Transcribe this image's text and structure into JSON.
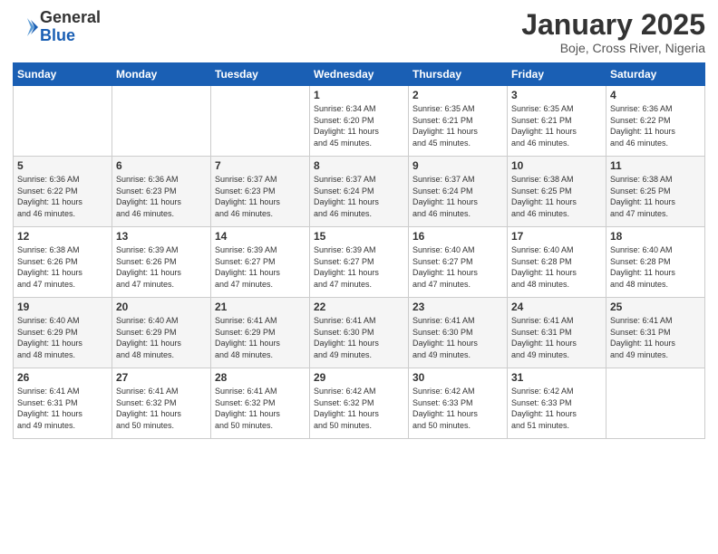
{
  "header": {
    "logo_general": "General",
    "logo_blue": "Blue",
    "month_title": "January 2025",
    "location": "Boje, Cross River, Nigeria"
  },
  "weekdays": [
    "Sunday",
    "Monday",
    "Tuesday",
    "Wednesday",
    "Thursday",
    "Friday",
    "Saturday"
  ],
  "weeks": [
    [
      {
        "day": "",
        "info": ""
      },
      {
        "day": "",
        "info": ""
      },
      {
        "day": "",
        "info": ""
      },
      {
        "day": "1",
        "info": "Sunrise: 6:34 AM\nSunset: 6:20 PM\nDaylight: 11 hours\nand 45 minutes."
      },
      {
        "day": "2",
        "info": "Sunrise: 6:35 AM\nSunset: 6:21 PM\nDaylight: 11 hours\nand 45 minutes."
      },
      {
        "day": "3",
        "info": "Sunrise: 6:35 AM\nSunset: 6:21 PM\nDaylight: 11 hours\nand 46 minutes."
      },
      {
        "day": "4",
        "info": "Sunrise: 6:36 AM\nSunset: 6:22 PM\nDaylight: 11 hours\nand 46 minutes."
      }
    ],
    [
      {
        "day": "5",
        "info": "Sunrise: 6:36 AM\nSunset: 6:22 PM\nDaylight: 11 hours\nand 46 minutes."
      },
      {
        "day": "6",
        "info": "Sunrise: 6:36 AM\nSunset: 6:23 PM\nDaylight: 11 hours\nand 46 minutes."
      },
      {
        "day": "7",
        "info": "Sunrise: 6:37 AM\nSunset: 6:23 PM\nDaylight: 11 hours\nand 46 minutes."
      },
      {
        "day": "8",
        "info": "Sunrise: 6:37 AM\nSunset: 6:24 PM\nDaylight: 11 hours\nand 46 minutes."
      },
      {
        "day": "9",
        "info": "Sunrise: 6:37 AM\nSunset: 6:24 PM\nDaylight: 11 hours\nand 46 minutes."
      },
      {
        "day": "10",
        "info": "Sunrise: 6:38 AM\nSunset: 6:25 PM\nDaylight: 11 hours\nand 46 minutes."
      },
      {
        "day": "11",
        "info": "Sunrise: 6:38 AM\nSunset: 6:25 PM\nDaylight: 11 hours\nand 47 minutes."
      }
    ],
    [
      {
        "day": "12",
        "info": "Sunrise: 6:38 AM\nSunset: 6:26 PM\nDaylight: 11 hours\nand 47 minutes."
      },
      {
        "day": "13",
        "info": "Sunrise: 6:39 AM\nSunset: 6:26 PM\nDaylight: 11 hours\nand 47 minutes."
      },
      {
        "day": "14",
        "info": "Sunrise: 6:39 AM\nSunset: 6:27 PM\nDaylight: 11 hours\nand 47 minutes."
      },
      {
        "day": "15",
        "info": "Sunrise: 6:39 AM\nSunset: 6:27 PM\nDaylight: 11 hours\nand 47 minutes."
      },
      {
        "day": "16",
        "info": "Sunrise: 6:40 AM\nSunset: 6:27 PM\nDaylight: 11 hours\nand 47 minutes."
      },
      {
        "day": "17",
        "info": "Sunrise: 6:40 AM\nSunset: 6:28 PM\nDaylight: 11 hours\nand 48 minutes."
      },
      {
        "day": "18",
        "info": "Sunrise: 6:40 AM\nSunset: 6:28 PM\nDaylight: 11 hours\nand 48 minutes."
      }
    ],
    [
      {
        "day": "19",
        "info": "Sunrise: 6:40 AM\nSunset: 6:29 PM\nDaylight: 11 hours\nand 48 minutes."
      },
      {
        "day": "20",
        "info": "Sunrise: 6:40 AM\nSunset: 6:29 PM\nDaylight: 11 hours\nand 48 minutes."
      },
      {
        "day": "21",
        "info": "Sunrise: 6:41 AM\nSunset: 6:29 PM\nDaylight: 11 hours\nand 48 minutes."
      },
      {
        "day": "22",
        "info": "Sunrise: 6:41 AM\nSunset: 6:30 PM\nDaylight: 11 hours\nand 49 minutes."
      },
      {
        "day": "23",
        "info": "Sunrise: 6:41 AM\nSunset: 6:30 PM\nDaylight: 11 hours\nand 49 minutes."
      },
      {
        "day": "24",
        "info": "Sunrise: 6:41 AM\nSunset: 6:31 PM\nDaylight: 11 hours\nand 49 minutes."
      },
      {
        "day": "25",
        "info": "Sunrise: 6:41 AM\nSunset: 6:31 PM\nDaylight: 11 hours\nand 49 minutes."
      }
    ],
    [
      {
        "day": "26",
        "info": "Sunrise: 6:41 AM\nSunset: 6:31 PM\nDaylight: 11 hours\nand 49 minutes."
      },
      {
        "day": "27",
        "info": "Sunrise: 6:41 AM\nSunset: 6:32 PM\nDaylight: 11 hours\nand 50 minutes."
      },
      {
        "day": "28",
        "info": "Sunrise: 6:41 AM\nSunset: 6:32 PM\nDaylight: 11 hours\nand 50 minutes."
      },
      {
        "day": "29",
        "info": "Sunrise: 6:42 AM\nSunset: 6:32 PM\nDaylight: 11 hours\nand 50 minutes."
      },
      {
        "day": "30",
        "info": "Sunrise: 6:42 AM\nSunset: 6:33 PM\nDaylight: 11 hours\nand 50 minutes."
      },
      {
        "day": "31",
        "info": "Sunrise: 6:42 AM\nSunset: 6:33 PM\nDaylight: 11 hours\nand 51 minutes."
      },
      {
        "day": "",
        "info": ""
      }
    ]
  ]
}
